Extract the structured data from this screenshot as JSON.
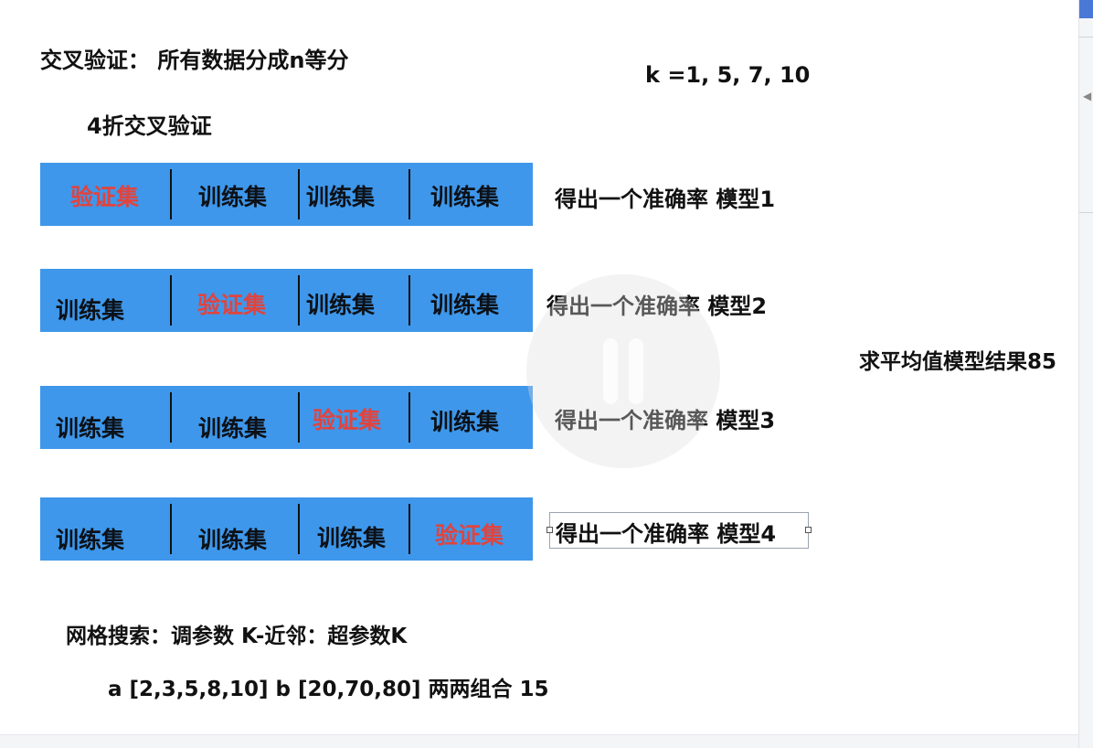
{
  "header": {
    "title": "交叉验证：  所有数据分成n等分",
    "k_values": "k =1,     5,   7, 10",
    "subtitle": "4折交叉验证"
  },
  "folds": [
    {
      "cells": [
        "验证集",
        "训练集",
        "训练集",
        "训练集"
      ],
      "validation_index": 0,
      "result": "得出一个准确率 模型1"
    },
    {
      "cells": [
        "训练集",
        "验证集",
        "训练集",
        "训练集"
      ],
      "validation_index": 1,
      "result": "得出一个准确率 模型2"
    },
    {
      "cells": [
        "训练集",
        "训练集",
        "验证集",
        "训练集"
      ],
      "validation_index": 2,
      "result": "得出一个准确率 模型3"
    },
    {
      "cells": [
        "训练集",
        "训练集",
        "训练集",
        "验证集"
      ],
      "validation_index": 3,
      "result": "得出一个准确率 模型4"
    }
  ],
  "average_label": "求平均值模型结果85",
  "grid_search": {
    "line1": "网格搜索：调参数  K-近邻：超参数K",
    "line2": "a  [2,3,5,8,10]       b  [20,70,80]    两两组合      15"
  },
  "colors": {
    "bar": "#3e97ea",
    "validation_text": "#e0443e",
    "training_text": "#0d1117"
  },
  "icons": {
    "overlay": "pause-icon",
    "cursor": "mouse-cursor-icon"
  }
}
